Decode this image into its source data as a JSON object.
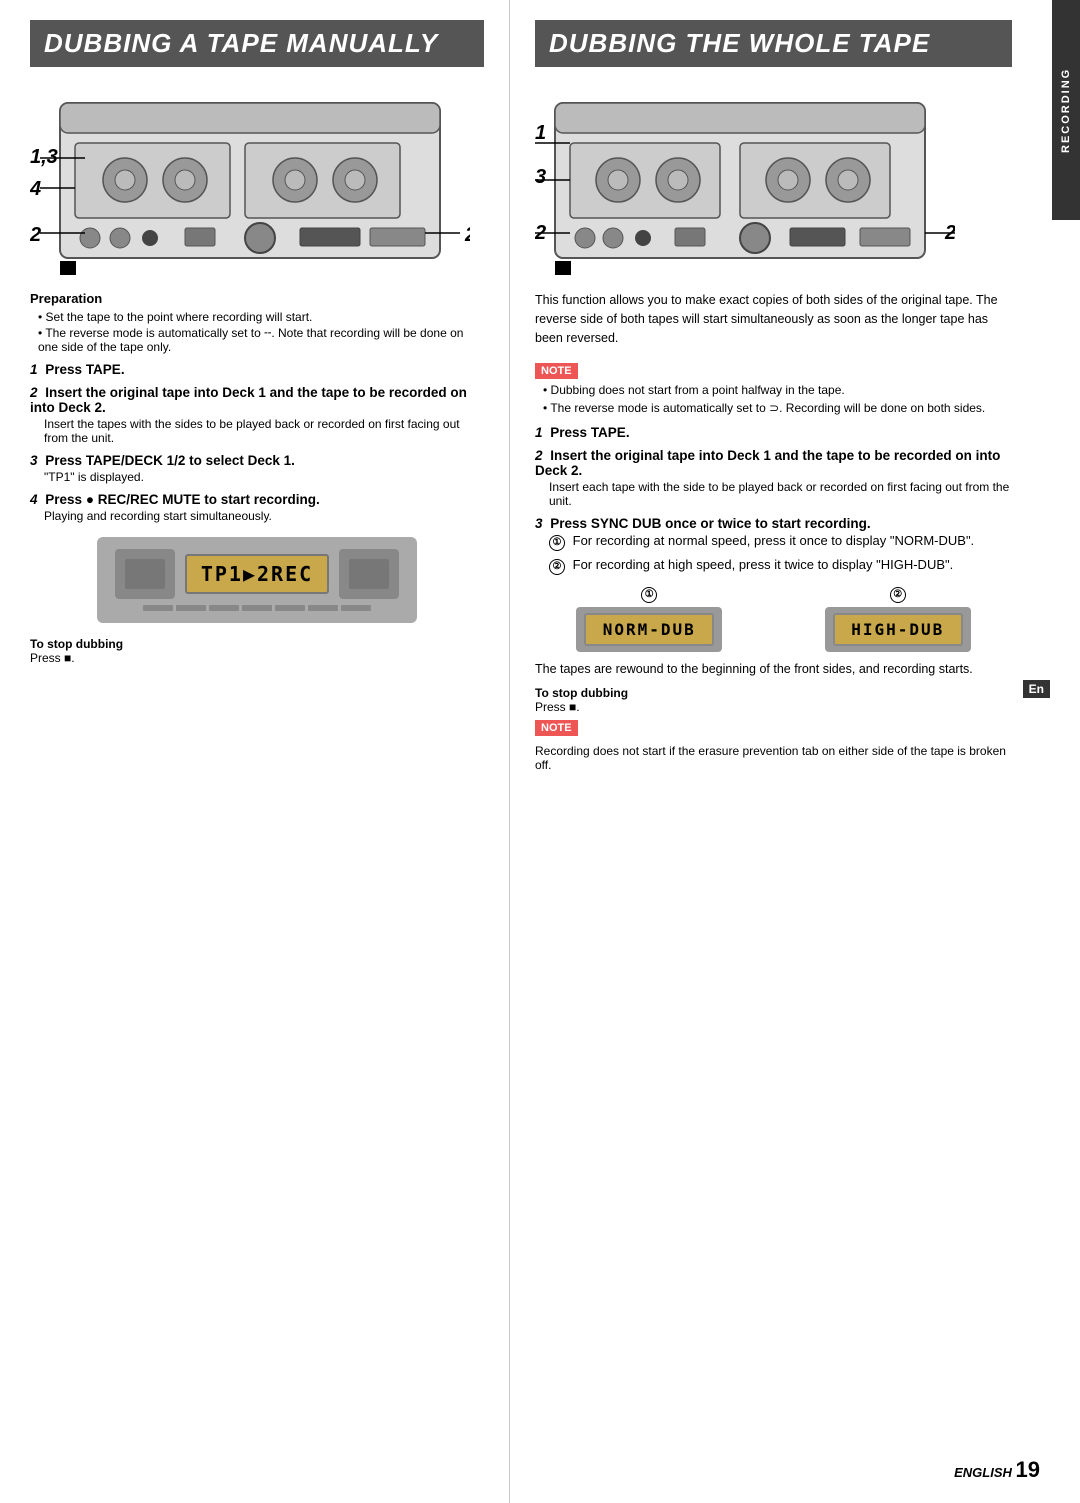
{
  "left": {
    "header": "DUBBING A TAPE MANUALLY",
    "preparation": {
      "title": "Preparation",
      "points": [
        "Set the tape to the point where recording will start.",
        "The reverse mode is automatically set to ╌. Note that recording will be done on one side of the tape only."
      ]
    },
    "steps": [
      {
        "num": "1",
        "bold_text": "Press TAPE."
      },
      {
        "num": "2",
        "bold_text": "Insert the original tape into Deck 1 and the tape to be recorded on into Deck 2.",
        "detail": "Insert the tapes with the sides to be played back or recorded on first facing out from the unit."
      },
      {
        "num": "3",
        "bold_text": "Press TAPE/DECK 1/2 to select Deck 1.",
        "detail": "\"TP1\" is displayed."
      },
      {
        "num": "4",
        "bold_text": "Press ● REC/REC MUTE to start recording.",
        "detail": "Playing and recording start simultaneously."
      }
    ],
    "display_text": "TP1▶2REC",
    "stop_dubbing": {
      "title": "To stop dubbing",
      "text": "Press ■."
    }
  },
  "right": {
    "header": "DUBBING THE WHOLE TAPE",
    "intro": "This function allows you to make exact copies of both sides of the original tape. The reverse side of both tapes will start simultaneously as soon as the longer tape has been reversed.",
    "note1": {
      "points": [
        "Dubbing does not start from a point halfway in the tape.",
        "The reverse mode is automatically set to ⊃. Recording will be done on both sides."
      ]
    },
    "steps": [
      {
        "num": "1",
        "bold_text": "Press TAPE."
      },
      {
        "num": "2",
        "bold_text": "Insert the original tape into Deck 1 and the tape to be recorded on into Deck 2.",
        "detail": "Insert each tape with the side to be played back or recorded on first facing out from the unit."
      },
      {
        "num": "3",
        "bold_text": "Press SYNC DUB once or twice to start recording.",
        "sub_steps": [
          {
            "num": "①",
            "text": "For recording at normal speed, press it once to display \"NORM-DUB\"."
          },
          {
            "num": "②",
            "text": "For recording at high speed, press it twice to display \"HIGH-DUB\"."
          }
        ],
        "display1": "NORM-DUB",
        "display2": "HIGH-DUB"
      }
    ],
    "tapes_rewound": "The tapes are rewound to the beginning of the front sides, and recording starts.",
    "stop_dubbing": {
      "title": "To stop dubbing",
      "text": "Press ■."
    },
    "note2": {
      "text": "Recording does not start if the erasure prevention tab on either side of the tape is broken off."
    }
  },
  "footer": {
    "english": "ENGLISH",
    "page_num": "19"
  },
  "recording_tab": "RECORDING",
  "en_badge": "En"
}
